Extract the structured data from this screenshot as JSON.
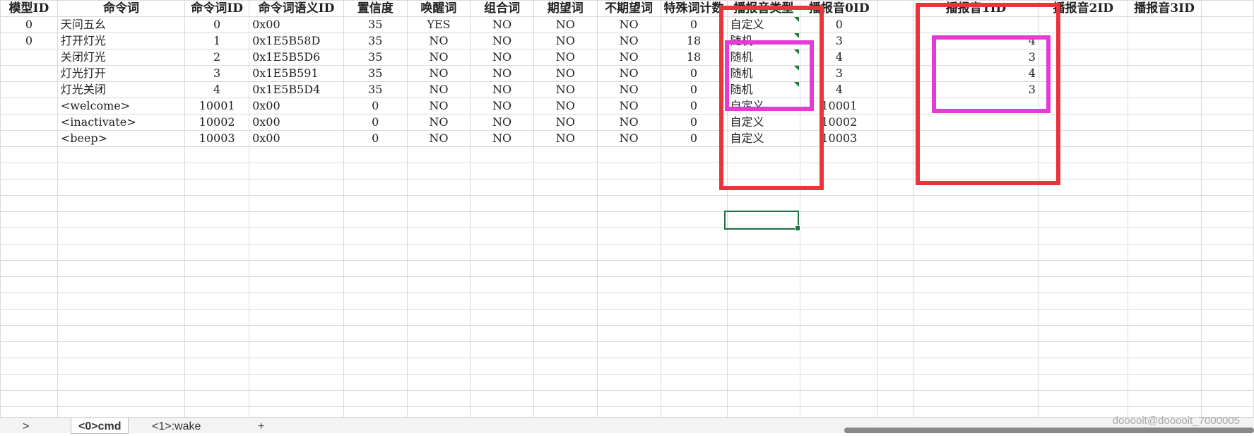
{
  "headers": [
    "模型ID",
    "命令词",
    "命令词ID",
    "命令词语义ID",
    "置信度",
    "唤醒词",
    "组合词",
    "期望词",
    "不期望词",
    "特殊词计数",
    "播报音类型",
    "播报音0ID",
    "",
    "播报音1ID",
    "播报音2ID",
    "播报音3ID"
  ],
  "rows": [
    {
      "model": "0",
      "word": "天问五幺",
      "id": "0",
      "sem": "0x00",
      "conf": "35",
      "wake": "YES",
      "combo": "NO",
      "expect": "NO",
      "unexpect": "NO",
      "special": "0",
      "type": "自定义",
      "b0": "0",
      "b1": ""
    },
    {
      "model": "0",
      "word": "打开灯光",
      "id": "1",
      "sem": "0x1E5B58D",
      "conf": "35",
      "wake": "NO",
      "combo": "NO",
      "expect": "NO",
      "unexpect": "NO",
      "special": "18",
      "type": "随机",
      "b0": "3",
      "b1": "4"
    },
    {
      "model": "",
      "word": "关闭灯光",
      "id": "2",
      "sem": "0x1E5B5D6",
      "conf": "35",
      "wake": "NO",
      "combo": "NO",
      "expect": "NO",
      "unexpect": "NO",
      "special": "18",
      "type": "随机",
      "b0": "4",
      "b1": "3"
    },
    {
      "model": "",
      "word": "灯光打开",
      "id": "3",
      "sem": "0x1E5B591",
      "conf": "35",
      "wake": "NO",
      "combo": "NO",
      "expect": "NO",
      "unexpect": "NO",
      "special": "0",
      "type": "随机",
      "b0": "3",
      "b1": "4"
    },
    {
      "model": "",
      "word": "灯光关闭",
      "id": "4",
      "sem": "0x1E5B5D4",
      "conf": "35",
      "wake": "NO",
      "combo": "NO",
      "expect": "NO",
      "unexpect": "NO",
      "special": "0",
      "type": "随机",
      "b0": "4",
      "b1": "3"
    },
    {
      "model": "",
      "word": "<welcome>",
      "id": "10001",
      "sem": "0x00",
      "conf": "0",
      "wake": "NO",
      "combo": "NO",
      "expect": "NO",
      "unexpect": "NO",
      "special": "0",
      "type": "自定义",
      "b0": "10001",
      "b1": ""
    },
    {
      "model": "",
      "word": "<inactivate>",
      "id": "10002",
      "sem": "0x00",
      "conf": "0",
      "wake": "NO",
      "combo": "NO",
      "expect": "NO",
      "unexpect": "NO",
      "special": "0",
      "type": "自定义",
      "b0": "10002",
      "b1": ""
    },
    {
      "model": "",
      "word": "<beep>",
      "id": "10003",
      "sem": "0x00",
      "conf": "0",
      "wake": "NO",
      "combo": "NO",
      "expect": "NO",
      "unexpect": "NO",
      "special": "0",
      "type": "自定义",
      "b0": "10003",
      "b1": ""
    }
  ],
  "tabs": {
    "prev_arrow": ">",
    "active": "<0>cmd",
    "second": "<1>:wake",
    "add": "+"
  },
  "watermark": "dooooit@dooooit_7000005",
  "colors": {
    "red_box": "#e8353a",
    "magenta_box": "#e53bd6",
    "selection": "#217346",
    "comment_marker": "#1e7a35"
  }
}
